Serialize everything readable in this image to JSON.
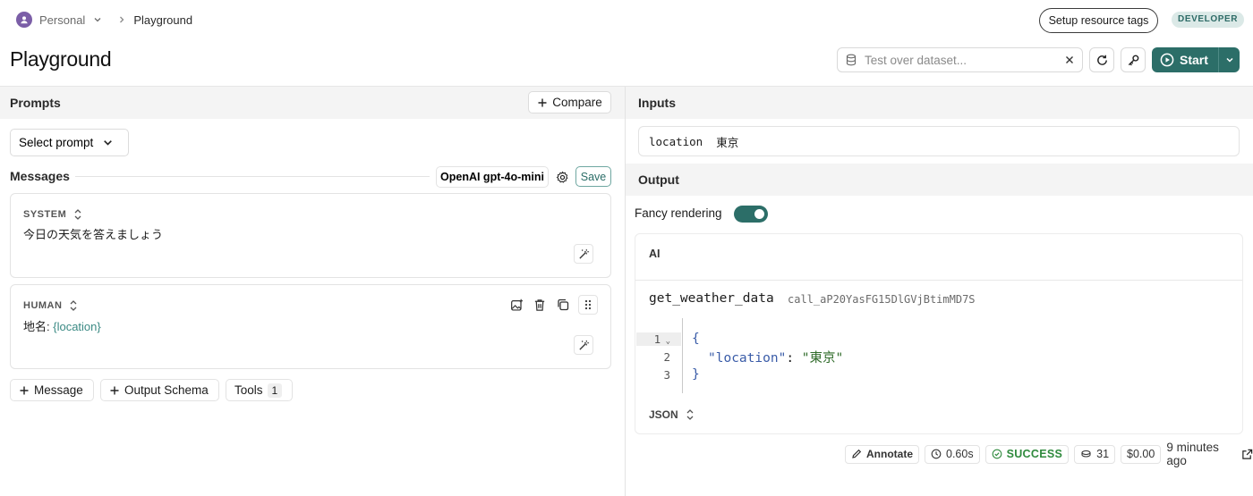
{
  "header": {
    "workspace": "Personal",
    "breadcrumb_current": "Playground",
    "setup_tags_label": "Setup resource tags",
    "env_badge": "DEVELOPER",
    "page_title": "Playground",
    "dataset_placeholder": "Test over dataset...",
    "start_label": "Start"
  },
  "prompts": {
    "section_title": "Prompts",
    "compare_label": "Compare",
    "select_prompt_label": "Select prompt",
    "messages_label": "Messages",
    "model_label": "OpenAI gpt-4o-mini",
    "save_label": "Save",
    "messages": [
      {
        "role": "SYSTEM",
        "text": "今日の天気を答えましょう"
      },
      {
        "role": "HUMAN",
        "text_prefix": "地名: ",
        "variable": "{location}"
      }
    ],
    "add_message_label": "Message",
    "output_schema_label": "Output Schema",
    "tools_label": "Tools",
    "tools_count": "1"
  },
  "inputs": {
    "section_title": "Inputs",
    "key": "location",
    "value": "東京"
  },
  "output": {
    "section_title": "Output",
    "fancy_rendering_label": "Fancy rendering",
    "fancy_rendering_on": true,
    "ai_label": "AI",
    "function_name": "get_weather_data",
    "call_id": "call_aP20YasFG15DlGVjBtimMD7S",
    "code": {
      "line_numbers": [
        "1",
        "2",
        "3"
      ],
      "open": "{",
      "key": "\"location\"",
      "colon": ": ",
      "value": "\"東京\"",
      "close": "}"
    },
    "format_label": "JSON"
  },
  "run_meta": {
    "annotate_label": "Annotate",
    "latency": "0.60s",
    "status": "SUCCESS",
    "tokens": "31",
    "cost": "$0.00",
    "time_ago": "9 minutes ago"
  },
  "colors": {
    "accent": "#2c6e68",
    "success": "#2f8a3d",
    "variable": "#3b8a84"
  }
}
